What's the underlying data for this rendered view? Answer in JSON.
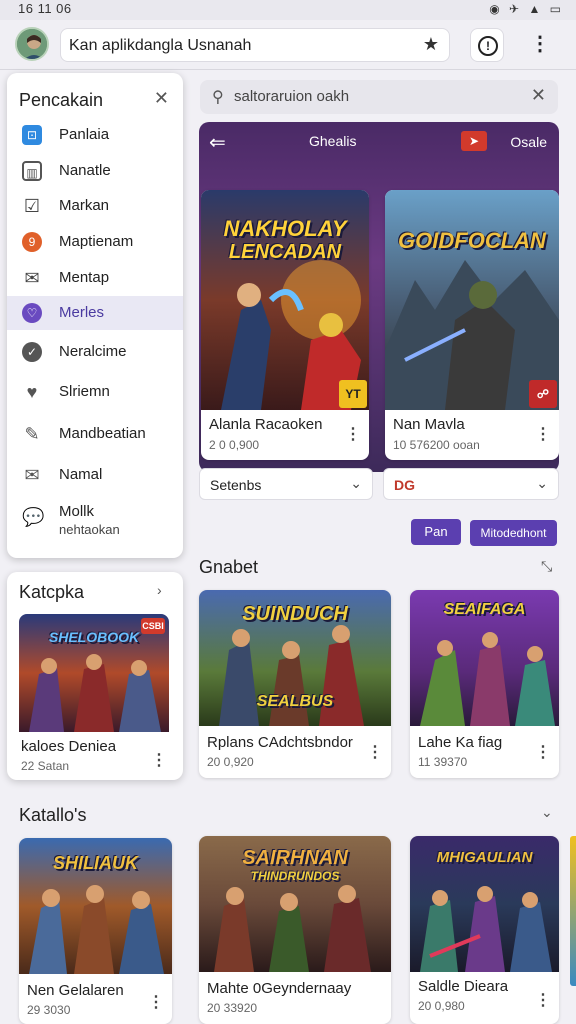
{
  "status": {
    "time": "16 11 06",
    "icons": "◉ ✈ ▲ ▭"
  },
  "topbar": {
    "url_text": "Kan aplikdangla Usnanah"
  },
  "search": {
    "placeholder": "saltoraruion oakh"
  },
  "banner": {
    "title": "Ghealis",
    "badge": "➤",
    "desc": "Osale"
  },
  "featured": [
    {
      "art_title_1": "NAKHOLAY",
      "art_title_2": "LENCADAN",
      "badge": "YT",
      "name": "Alanla Racaoken",
      "meta": "2 0 0,900"
    },
    {
      "art_title_1": "GOIDFOCLAN",
      "art_title_2": "",
      "badge": "☍",
      "name": "Nan Mavla",
      "meta": "10 576200 ooan"
    }
  ],
  "selects": [
    {
      "value": "Setenbs"
    },
    {
      "value": "DG"
    }
  ],
  "buttons": {
    "pan": "Pan",
    "mitedent": "Mitodedhont"
  },
  "drawer": {
    "title": "Pencakain",
    "items": [
      {
        "label": "Panlaia",
        "sub": ""
      },
      {
        "label": "Nanatle",
        "sub": ""
      },
      {
        "label": "Markan",
        "sub": ""
      },
      {
        "label": "Maptienam",
        "sub": ""
      },
      {
        "label": "Mentap",
        "sub": ""
      },
      {
        "label": "Merles",
        "sub": ""
      },
      {
        "label": "Neralcime",
        "sub": ""
      },
      {
        "label": "Slriemn",
        "sub": ""
      },
      {
        "label": "Mandbeatian",
        "sub": ""
      },
      {
        "label": "Namal",
        "sub": ""
      },
      {
        "label": "Mollk",
        "sub": "nehtaokan"
      }
    ]
  },
  "side_section": {
    "title": "Katcpka",
    "card": {
      "art_title": "SHELOBOOK",
      "badge": "CSBI",
      "name": "kaloes Deniea",
      "meta": "22 Satan"
    }
  },
  "gnabet": {
    "title": "Gnabet",
    "cards": [
      {
        "art_title_1": "SUINDUCH",
        "art_title_2": "SEALBUS",
        "name": "Rplans CAdchtsbndor",
        "meta": "20 0,920"
      },
      {
        "art_title_1": "SEAIFAGA",
        "art_title_2": "",
        "name": "Lahe Ka fiag",
        "meta": "11 39370"
      }
    ]
  },
  "katatalos": {
    "title": "Katallo's",
    "cards": [
      {
        "art_title_1": "SHILIAUK",
        "art_title_2": "",
        "name": "Nen Gelalaren",
        "meta": "29 3030"
      },
      {
        "art_title_1": "SAIRHNAN",
        "art_title_2": "THINDRUNDOS",
        "name": "Mahte 0Geyndernaay",
        "meta": "20 33920"
      },
      {
        "art_title_1": "MHIGAULIAN",
        "art_title_2": "",
        "name": "Saldle Dieara",
        "meta": "20 0,980"
      }
    ]
  },
  "colors": {
    "accent": "#5b3fb0",
    "drawer_active": "#e9e8f4"
  }
}
